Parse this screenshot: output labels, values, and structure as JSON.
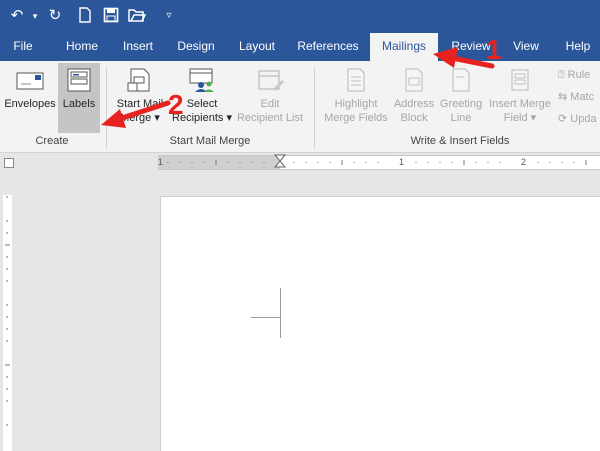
{
  "quick_access": {
    "icons": [
      "undo-icon",
      "redo-icon",
      "new-document-icon",
      "save-icon",
      "open-icon",
      "customize-icon"
    ]
  },
  "tabs": [
    {
      "label": "File"
    },
    {
      "label": "Home"
    },
    {
      "label": "Insert"
    },
    {
      "label": "Design"
    },
    {
      "label": "Layout"
    },
    {
      "label": "References"
    },
    {
      "label": "Mailings"
    },
    {
      "label": "Review"
    },
    {
      "label": "View"
    },
    {
      "label": "Help"
    }
  ],
  "ribbon": {
    "create": {
      "group_label": "Create",
      "envelopes": "Envelopes",
      "labels": "Labels"
    },
    "start_mail_merge": {
      "group_label": "Start Mail Merge",
      "start_line1": "Start Mail",
      "start_line2": "Merge",
      "select_line1": "Select",
      "select_line2": "Recipients",
      "edit_line1": "Edit",
      "edit_line2": "Recipient List"
    },
    "write_insert": {
      "group_label": "Write & Insert Fields",
      "highlight_line1": "Highlight",
      "highlight_line2": "Merge Fields",
      "address_line1": "Address",
      "address_line2": "Block",
      "greeting_line1": "Greeting",
      "greeting_line2": "Line",
      "insert_line1": "Insert Merge",
      "insert_line2": "Field",
      "rules": "Rule",
      "match": "Matc",
      "update": "Upda"
    }
  },
  "ruler": {
    "numbers": [
      "1",
      "1",
      "2"
    ]
  },
  "annotations": {
    "marker1": "1",
    "marker2": "2",
    "arrow_color": "#e8231f"
  },
  "colors": {
    "accent": "#2b579a"
  }
}
